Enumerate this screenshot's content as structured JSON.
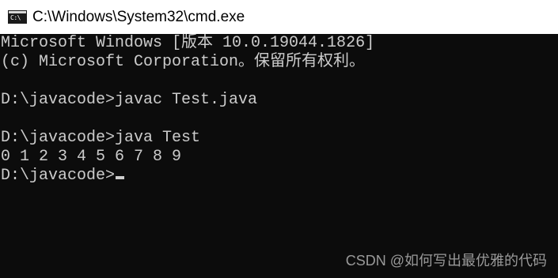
{
  "window": {
    "title": "C:\\Windows\\System32\\cmd.exe",
    "icon": "cmd-console-icon",
    "icon_text": "C:\\"
  },
  "console": {
    "lines": [
      "Microsoft Windows [版本 10.0.19044.1826]",
      "(c) Microsoft Corporation。保留所有权利。",
      "",
      "D:\\javacode>javac Test.java",
      "",
      "D:\\javacode>java Test",
      "0 1 2 3 4 5 6 7 8 9",
      "D:\\javacode>"
    ],
    "colors": {
      "background": "#0c0c0c",
      "text": "#cccccc"
    }
  },
  "watermark": {
    "text": "CSDN @如何写出最优雅的代码"
  }
}
